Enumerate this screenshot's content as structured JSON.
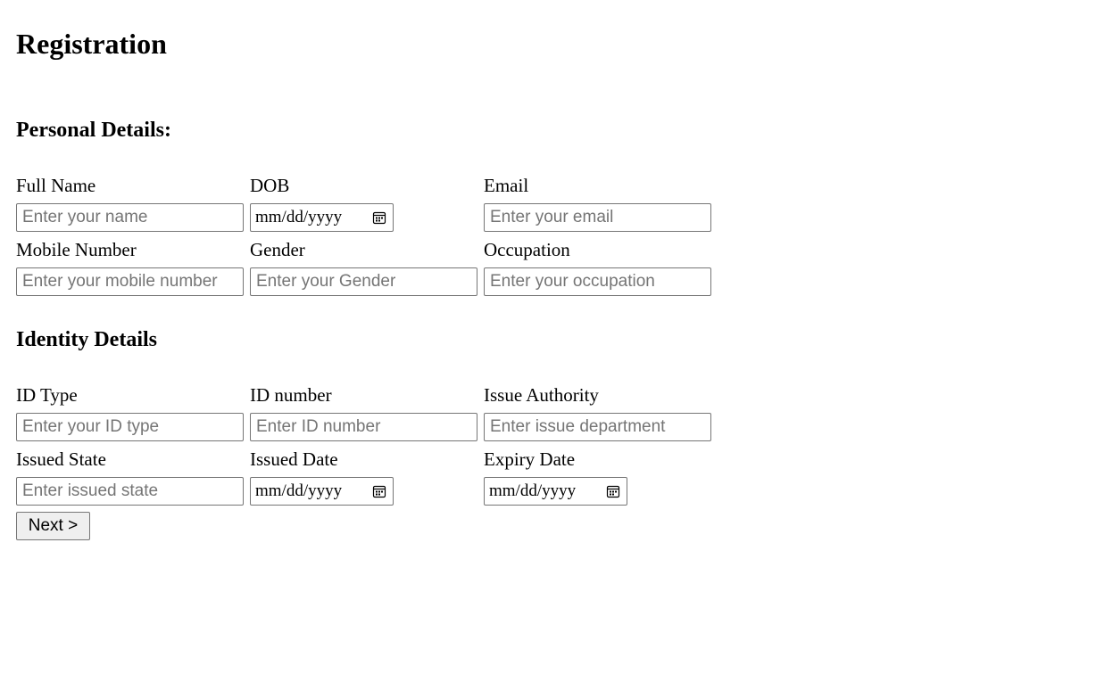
{
  "page": {
    "title": "Registration"
  },
  "personal": {
    "heading": "Personal Details:",
    "fields": {
      "full_name": {
        "label": "Full Name",
        "placeholder": "Enter your name"
      },
      "dob": {
        "label": "DOB",
        "format": "mm/dd/yyyy"
      },
      "email": {
        "label": "Email",
        "placeholder": "Enter your email"
      },
      "mobile": {
        "label": "Mobile Number",
        "placeholder": "Enter your mobile number"
      },
      "gender": {
        "label": "Gender",
        "placeholder": "Enter your Gender"
      },
      "occupation": {
        "label": "Occupation",
        "placeholder": "Enter your occupation"
      }
    }
  },
  "identity": {
    "heading": "Identity Details",
    "fields": {
      "id_type": {
        "label": "ID Type",
        "placeholder": "Enter your ID type"
      },
      "id_number": {
        "label": "ID number",
        "placeholder": "Enter ID number"
      },
      "issue_authority": {
        "label": "Issue Authority",
        "placeholder": "Enter issue department"
      },
      "issued_state": {
        "label": "Issued State",
        "placeholder": "Enter issued state"
      },
      "issued_date": {
        "label": "Issued Date",
        "format": "mm/dd/yyyy"
      },
      "expiry_date": {
        "label": "Expiry Date",
        "format": "mm/dd/yyyy"
      }
    }
  },
  "actions": {
    "next_label": "Next >"
  },
  "icons": {
    "date_picker": "calendar-icon"
  },
  "colors": {
    "input_border": "#767676",
    "placeholder": "#757575",
    "button_background": "#efefef"
  }
}
